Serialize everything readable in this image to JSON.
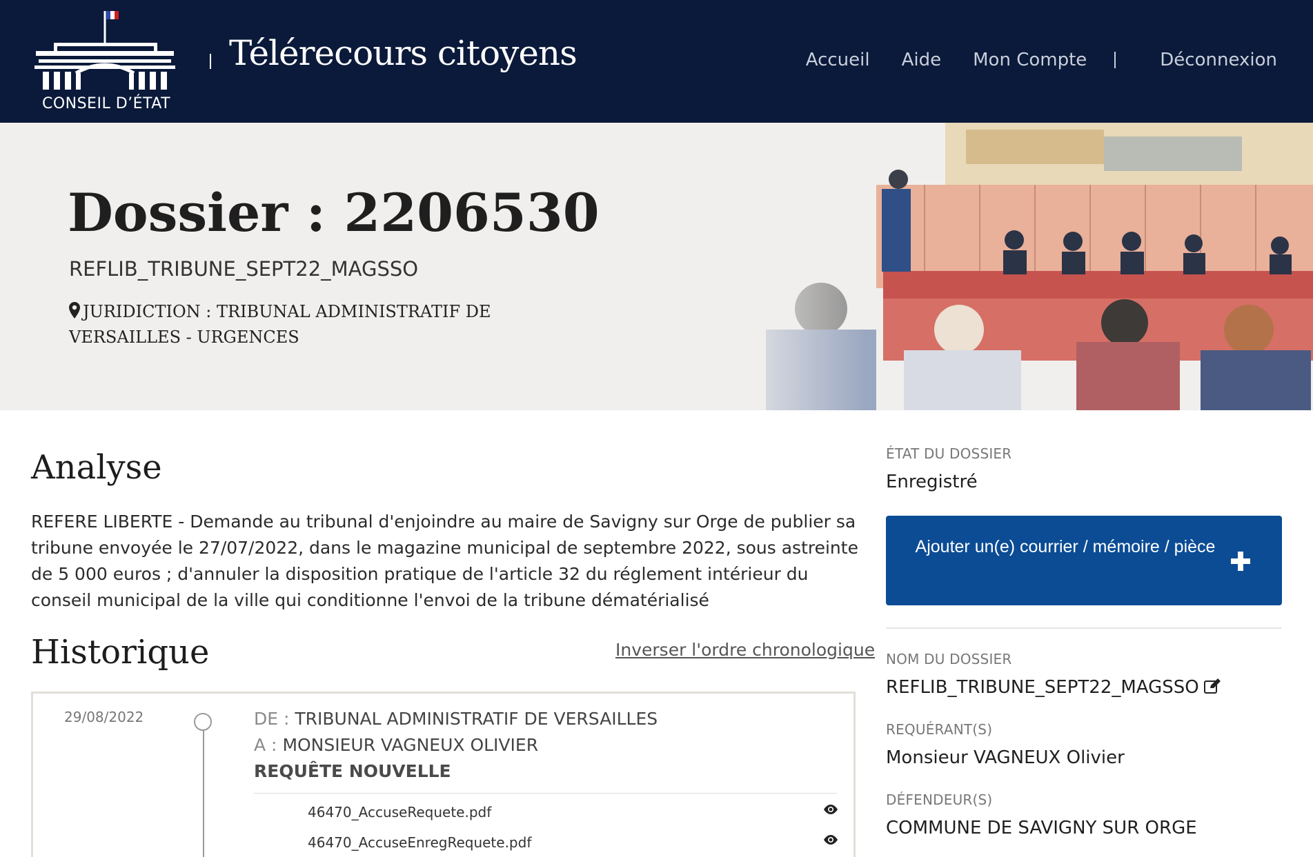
{
  "header": {
    "logo_text": "CONSEIL D’ÉTAT",
    "brand": "Télérecours citoyens",
    "nav": {
      "home": "Accueil",
      "help": "Aide",
      "account": "Mon Compte",
      "logout": "Déconnexion"
    },
    "colors": {
      "background": "#0b1a3a",
      "nav_text": "#c9cfdb"
    }
  },
  "hero": {
    "title": "Dossier : 2206530",
    "reference": "REFLIB_TRIBUNE_SEPT22_MAGSSO",
    "juridiction": "JURIDICTION : TRIBUNAL ADMINISTRATIF DE VERSAILLES - URGENCES",
    "icon": "map-pin-icon"
  },
  "analyse": {
    "title": "Analyse",
    "text": "REFERE LIBERTE - Demande au tribunal d'enjoindre au maire de Savigny sur Orge de publier sa tribune envoyée le 27/07/2022, dans le magazine municipal de septembre 2022, sous astreinte de 5 000 euros ; d'annuler la disposition pratique de l'article 32 du réglement intérieur du conseil municipal de la ville qui conditionne l'envoi de la tribune dématérialisé"
  },
  "historique": {
    "title": "Historique",
    "invert_link": "Inverser l'ordre chronologique",
    "entries": [
      {
        "date": "29/08/2022",
        "from_label": "DE :",
        "from": "TRIBUNAL ADMINISTRATIF DE VERSAILLES",
        "to_label": "A :",
        "to": "MONSIEUR VAGNEUX OLIVIER",
        "type": "REQUÊTE NOUVELLE",
        "files": [
          "46470_AccuseRequete.pdf",
          "46470_AccuseEnregRequete.pdf"
        ]
      }
    ]
  },
  "sidebar": {
    "etat_label": "ÉTAT DU DOSSIER",
    "etat_value": "Enregistré",
    "add_button": "Ajouter un(e) courrier / mémoire / pièce",
    "nom_label": "NOM DU DOSSIER",
    "nom_value": "REFLIB_TRIBUNE_SEPT22_MAGSSO",
    "requerant_label": "REQUÉRANT(S)",
    "requerant_value": "Monsieur VAGNEUX Olivier",
    "defendeur_label": "DÉFENDEUR(S)",
    "defendeur_value": "COMMUNE DE SAVIGNY SUR ORGE",
    "colors": {
      "button": "#0b4c95"
    }
  }
}
